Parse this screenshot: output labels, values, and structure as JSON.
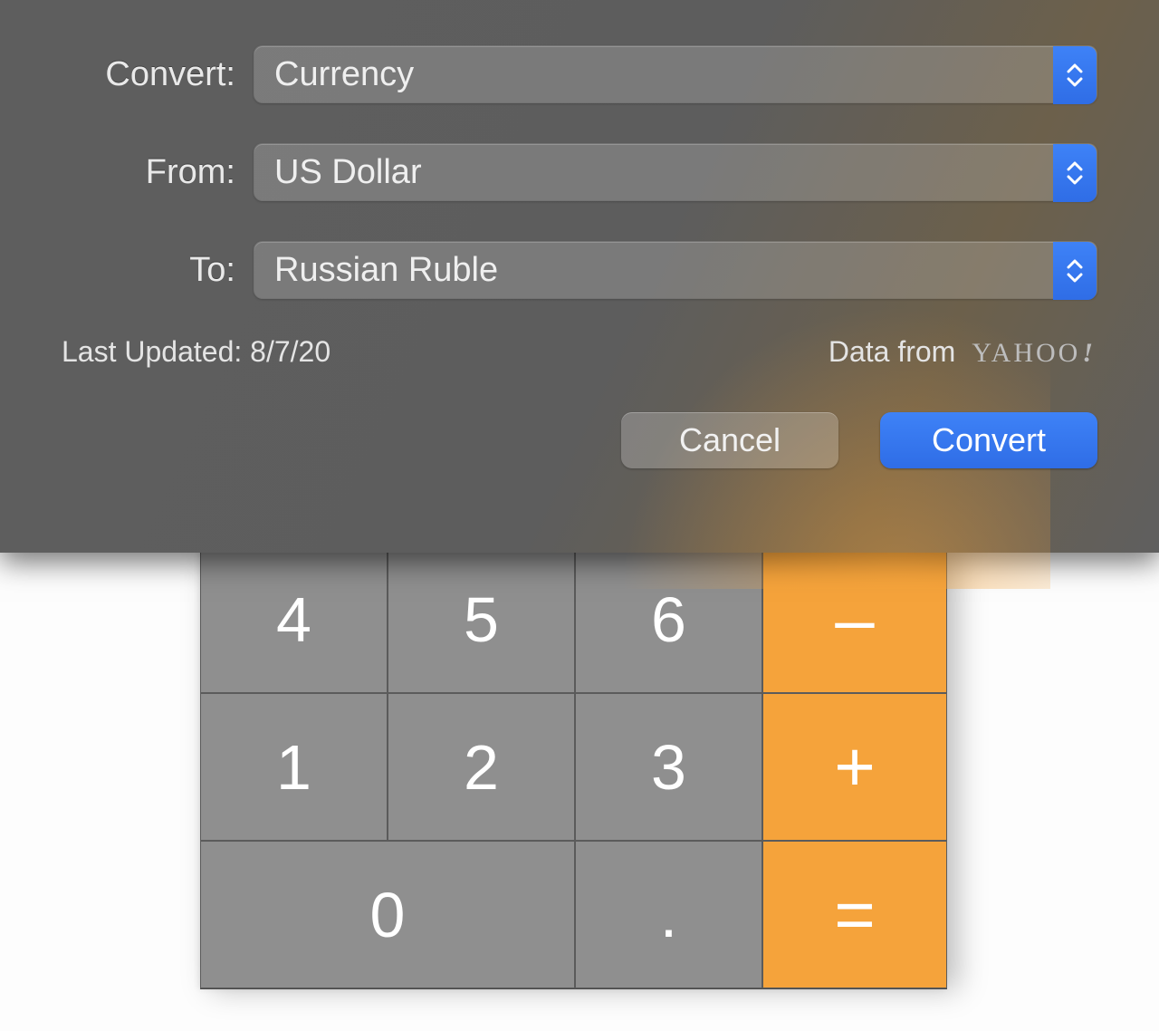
{
  "dialog": {
    "fields": {
      "convert": {
        "label": "Convert:",
        "value": "Currency"
      },
      "from": {
        "label": "From:",
        "value": "US Dollar"
      },
      "to": {
        "label": "To:",
        "value": "Russian Ruble"
      }
    },
    "last_updated_label": "Last Updated: 8/7/20",
    "data_from_label": "Data from",
    "provider_name": "YAHOO",
    "provider_bang": "!",
    "buttons": {
      "cancel": "Cancel",
      "convert": "Convert"
    }
  },
  "keypad": {
    "row1": {
      "a": "4",
      "b": "5",
      "c": "6",
      "op": "–"
    },
    "row2": {
      "a": "1",
      "b": "2",
      "c": "3",
      "op": "+"
    },
    "row3": {
      "a": "0",
      "b": ".",
      "op": "="
    }
  },
  "colors": {
    "accent_blue": "#2f6de6",
    "operator_orange": "#f5a33b",
    "key_grey": "#8f8f8f"
  }
}
